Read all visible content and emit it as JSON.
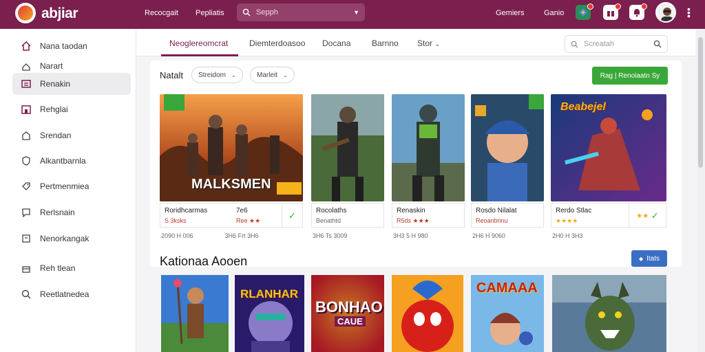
{
  "app": {
    "brand": "abjiar"
  },
  "topbar": {
    "links": [
      "Recocgait",
      "Pepliatis"
    ],
    "search_placeholder": "Sepph",
    "right_links": [
      "Gemiers",
      "Ganio"
    ]
  },
  "sidebar": {
    "items": [
      {
        "label": "Nana taodan",
        "icon": "home-icon"
      },
      {
        "label": "Narart",
        "icon": "user-icon"
      },
      {
        "label": "Renakin",
        "icon": "grid-icon",
        "active": true
      },
      {
        "label": "Rehglai",
        "icon": "store-icon"
      },
      {
        "label": "Srendan",
        "icon": "house-icon"
      },
      {
        "label": "Alkantbarnla",
        "icon": "shield-icon"
      },
      {
        "label": "Pertmenmiea",
        "icon": "tag-icon"
      },
      {
        "label": "Rerlsnain",
        "icon": "chat-icon"
      },
      {
        "label": "Nenorkangak",
        "icon": "box-icon"
      },
      {
        "label": "Reh tlean",
        "icon": "gift-icon"
      },
      {
        "label": "Reetlatnedea",
        "icon": "search-icon"
      }
    ]
  },
  "tabs": [
    "Neoglereomcrat",
    "Diemterdoasoo",
    "Docana",
    "Barnno",
    "Stor"
  ],
  "right_search_placeholder": "Screatah",
  "panel": {
    "label": "Natalt",
    "chips": [
      "Streidom",
      "Marleit"
    ],
    "green_button": "Rag | Renoiaatn Sy"
  },
  "cards": [
    {
      "art_text": "MALKSMEN",
      "title": "Roridhcarmas",
      "sub": "S 3ksks",
      "side_val": "7e6",
      "side_sub": "Ree ★★",
      "meta": "2090 H 006",
      "meta2": "3H6 Frt 3H6",
      "checked": true
    },
    {
      "title": "Rocolaths",
      "sub": "Benathtd",
      "meta": "3H6 Ts 3009",
      "checked": false
    },
    {
      "title": "Renaskin",
      "sub": "R5ds ★★★",
      "meta": "3H3 5 H 980",
      "checked": false
    },
    {
      "title": "Rosdo Nilalat",
      "sub": "Reoanbrinu",
      "meta": "2H6 H 9060",
      "checked": false
    },
    {
      "art_text": "Beabejel",
      "title": "Rerdo Stlac",
      "sub": "★★★★",
      "meta": "2H0 H 3H3",
      "checked": true
    }
  ],
  "section2": {
    "title": "Kationaa Aooen",
    "button": "Itats"
  },
  "tiles": [
    {
      "art_text": ""
    },
    {
      "art_text": "RLANHAR"
    },
    {
      "art_text": "BONHAO",
      "art_sub": "CAUE"
    },
    {
      "art_text": ""
    },
    {
      "art_text": "CAMAAA"
    },
    {
      "art_text": ""
    }
  ],
  "colors": {
    "topbar": "#7a1f4e",
    "accent_green": "#3aa73a",
    "accent_blue": "#3b6fc4"
  }
}
